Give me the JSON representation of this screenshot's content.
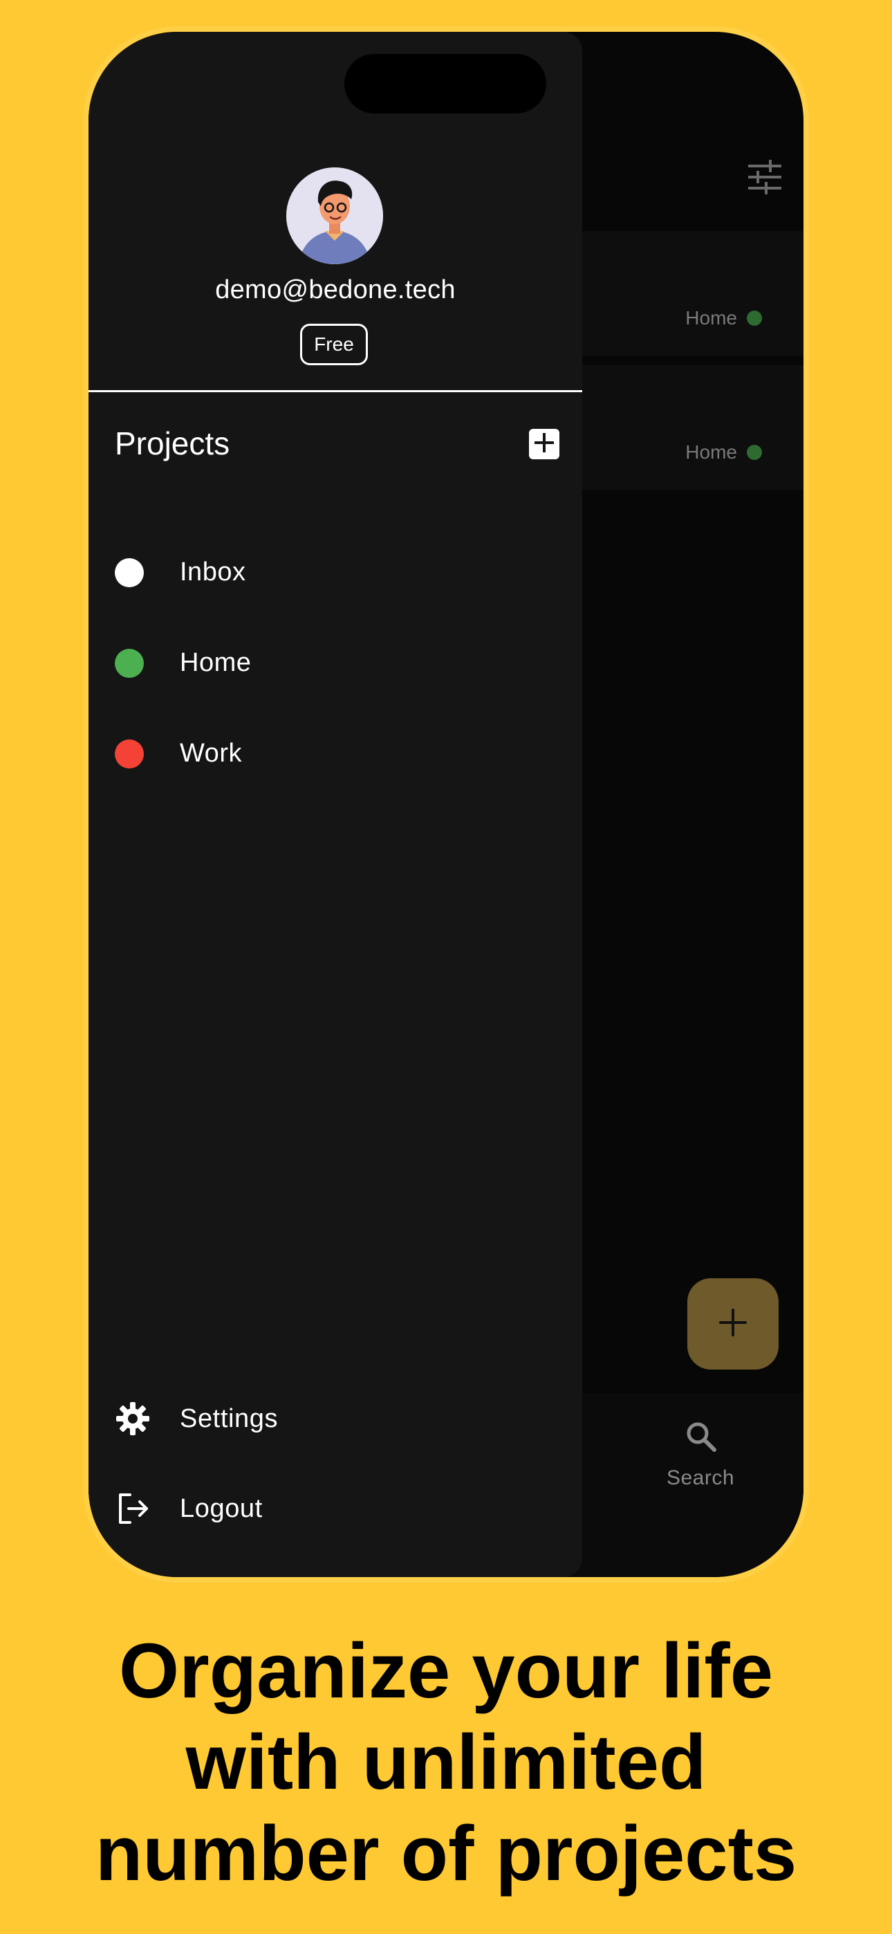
{
  "colors": {
    "page_background": "#FFC933",
    "drawer_background": "#151515",
    "fab_color": "#6E5A2A",
    "project_inbox": "#FFFFFF",
    "project_home": "#4CAF50",
    "project_work": "#F44336",
    "task_tag_dot": "#2E6B31"
  },
  "background_app": {
    "toolbar": {
      "filter_icon": "tune-icon"
    },
    "tasks": [
      {
        "tag": "Home"
      },
      {
        "tag": "Home"
      }
    ],
    "fab_icon": "plus-icon",
    "bottom_nav": {
      "search_label": "Search",
      "search_icon": "search-icon"
    }
  },
  "drawer": {
    "profile": {
      "avatar": "avatar-illustration",
      "email": "demo@bedone.tech",
      "plan": "Free"
    },
    "projects": {
      "title": "Projects",
      "add_icon": "plus-box-icon",
      "items": [
        {
          "name": "Inbox",
          "color": "#FFFFFF"
        },
        {
          "name": "Home",
          "color": "#4CAF50"
        },
        {
          "name": "Work",
          "color": "#F44336"
        }
      ]
    },
    "menu": {
      "settings": {
        "label": "Settings",
        "icon": "gear-icon"
      },
      "logout": {
        "label": "Logout",
        "icon": "logout-icon"
      }
    }
  },
  "headline": {
    "line1": "Organize your life",
    "line2": "with unlimited",
    "line3": "number of projects"
  }
}
